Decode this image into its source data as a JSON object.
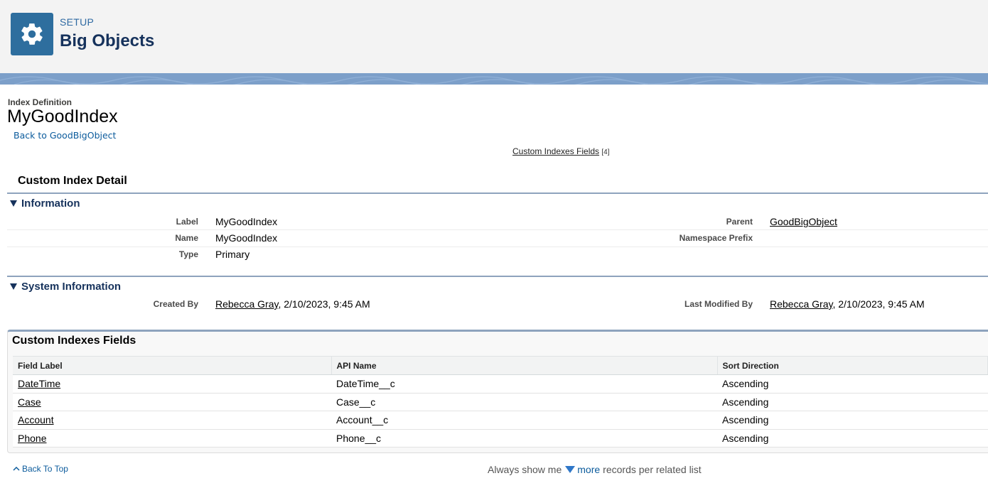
{
  "header": {
    "eyebrow": "SETUP",
    "title": "Big Objects",
    "icon": "gear-icon",
    "icon_bg": "#2e6e9e"
  },
  "page": {
    "eyebrow": "Index Definition",
    "title": "MyGoodIndex",
    "back_link": "Back to GoodBigObject"
  },
  "related_link": {
    "label": "Custom Indexes Fields",
    "count": "[4]"
  },
  "detail": {
    "title": "Custom Index Detail",
    "information": {
      "heading": "Information",
      "label_label": "Label",
      "label_value": "MyGoodIndex",
      "name_label": "Name",
      "name_value": "MyGoodIndex",
      "type_label": "Type",
      "type_value": "Primary",
      "parent_label": "Parent",
      "parent_value": "GoodBigObject",
      "namespace_label": "Namespace Prefix",
      "namespace_value": ""
    },
    "system": {
      "heading": "System Information",
      "created_label": "Created By",
      "created_user": "Rebecca Gray",
      "created_date": ", 2/10/2023, 9:45 AM",
      "modified_label": "Last Modified By",
      "modified_user": "Rebecca Gray",
      "modified_date": ", 2/10/2023, 9:45 AM"
    }
  },
  "related_list": {
    "title": "Custom Indexes Fields",
    "columns": [
      "Field Label",
      "API Name",
      "Sort Direction"
    ],
    "rows": [
      [
        "DateTime",
        "DateTime__c",
        "Ascending"
      ],
      [
        "Case",
        "Case__c",
        "Ascending"
      ],
      [
        "Account",
        "Account__c",
        "Ascending"
      ],
      [
        "Phone",
        "Phone__c",
        "Ascending"
      ]
    ]
  },
  "footer": {
    "back_to_top": "Back To Top",
    "always_show": "Always show me",
    "more": "more",
    "per_list": "records per related list"
  }
}
